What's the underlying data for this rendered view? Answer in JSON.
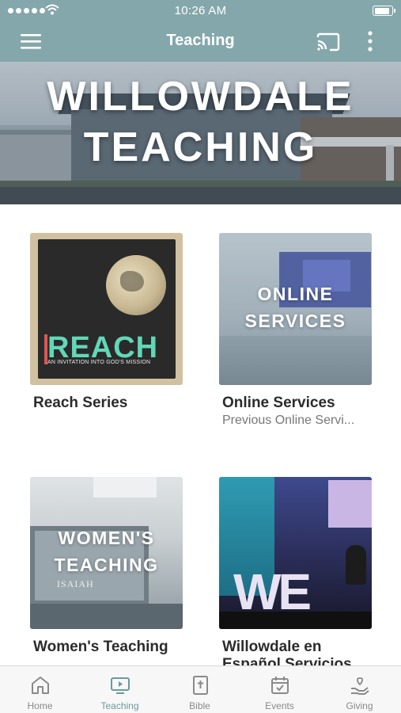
{
  "status_bar": {
    "time": "10:26 AM"
  },
  "app_bar": {
    "title": "Teaching"
  },
  "hero": {
    "line1": "WILLOWDALE",
    "line2": "TEACHING"
  },
  "cards": [
    {
      "title": "Reach Series",
      "subtitle": "",
      "thumb_text": "REACH",
      "thumb_subtext": "AN INVITATION INTO GOD'S MISSION"
    },
    {
      "title": "Online Services",
      "subtitle": "Previous Online Servi...",
      "thumb_line1": "ONLINE",
      "thumb_line2": "SERVICES"
    },
    {
      "title": "Women's Teaching",
      "subtitle": "",
      "thumb_line1": "WOMEN'S",
      "thumb_line2": "TEACHING",
      "thumb_subtext": "ISAIAH"
    },
    {
      "title": "Willowdale en",
      "title2": "Español Servicios",
      "subtitle": "",
      "thumb_text": "WE"
    }
  ],
  "bottom_nav": {
    "active": "Teaching",
    "items": [
      {
        "label": "Home",
        "icon": "home-icon"
      },
      {
        "label": "Teaching",
        "icon": "tv-play-icon"
      },
      {
        "label": "Bible",
        "icon": "bible-icon"
      },
      {
        "label": "Events",
        "icon": "calendar-check-icon"
      },
      {
        "label": "Giving",
        "icon": "hand-heart-icon"
      }
    ]
  },
  "colors": {
    "accent": "#84a7ab",
    "nav_active": "#6b9aa0",
    "nav_inactive": "#8a8a8a",
    "reach_green": "#62d7b8"
  }
}
